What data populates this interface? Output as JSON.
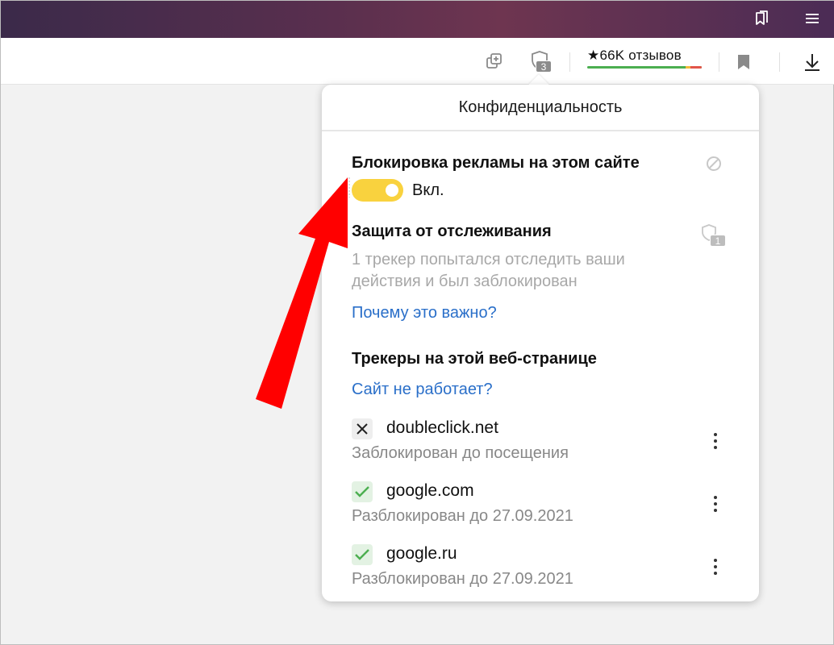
{
  "toolbar": {
    "shield_badge": "3",
    "reviews_label": "★66K отзывов"
  },
  "popup": {
    "title": "Конфиденциальность",
    "ad_block": {
      "heading": "Блокировка рекламы на этом сайте",
      "toggle_label": "Вкл."
    },
    "tracking": {
      "heading": "Защита от отслеживания",
      "badge": "1",
      "description_line1": "1 трекер попытался отследить ваши",
      "description_line2": "действия и был заблокирован",
      "why_link": "Почему это важно?"
    },
    "trackers": {
      "heading": "Трекеры на этой веб-странице",
      "broken_link": "Сайт не работает?",
      "items": [
        {
          "domain": "doubleclick.net",
          "status": "Заблокирован до посещения",
          "icon": "close-icon"
        },
        {
          "domain": "google.com",
          "status": "Разблокирован до 27.09.2021",
          "icon": "check-icon"
        },
        {
          "domain": "google.ru",
          "status": "Разблокирован до 27.09.2021",
          "icon": "check-icon"
        }
      ]
    }
  },
  "colors": {
    "toggle": "#f9d23e",
    "link": "#2a6fc9",
    "check": "#4caf50",
    "arrow": "#ff0000"
  }
}
